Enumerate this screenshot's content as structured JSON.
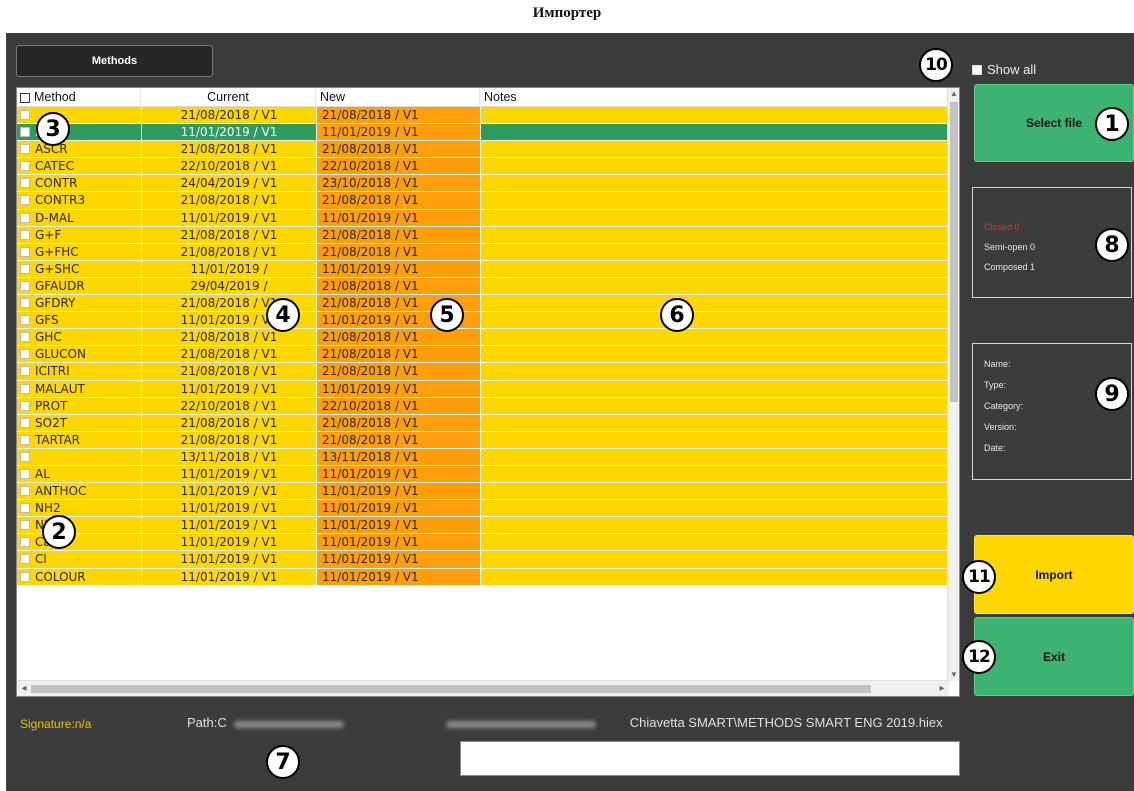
{
  "page_title": "Импортер",
  "tab_methods": "Methods",
  "show_all": "Show all",
  "table": {
    "headers": [
      "Method",
      "Current",
      "New",
      "Notes"
    ],
    "rows": [
      {
        "method": "",
        "current": "21/08/2018 / V1",
        "new": "21/08/2018 / V1",
        "notes": ""
      },
      {
        "method": "RB",
        "current": "11/01/2019 / V1",
        "new": "11/01/2019 / V1",
        "notes": "",
        "selected": true
      },
      {
        "method": "ASCR",
        "current": "21/08/2018 / V1",
        "new": "21/08/2018 / V1",
        "notes": ""
      },
      {
        "method": "CATEC",
        "current": "22/10/2018 / V1",
        "new": "22/10/2018 / V1",
        "notes": ""
      },
      {
        "method": "CONTR",
        "current": "24/04/2019 / V1",
        "new": "23/10/2018 / V1",
        "notes": ""
      },
      {
        "method": "CONTR3",
        "current": "21/08/2018 / V1",
        "new": "21/08/2018 / V1",
        "notes": ""
      },
      {
        "method": "D-MAL",
        "current": "11/01/2019 / V1",
        "new": "11/01/2019 / V1",
        "notes": ""
      },
      {
        "method": "G+F",
        "current": "21/08/2018 / V1",
        "new": "21/08/2018 / V1",
        "notes": ""
      },
      {
        "method": "G+FHC",
        "current": "21/08/2018 / V1",
        "new": "21/08/2018 / V1",
        "notes": ""
      },
      {
        "method": "G+SHC",
        "current": "11/01/2019 /",
        "new": "11/01/2019 / V1",
        "notes": ""
      },
      {
        "method": "GFAUDR",
        "current": "29/04/2019 /",
        "new": "21/08/2018 / V1",
        "notes": ""
      },
      {
        "method": "GFDRY",
        "current": "21/08/2018 / V1",
        "new": "21/08/2018 / V1",
        "notes": ""
      },
      {
        "method": "GFS",
        "current": "11/01/2019 / V1",
        "new": "11/01/2019 / V1",
        "notes": ""
      },
      {
        "method": "GHC",
        "current": "21/08/2018 / V1",
        "new": "21/08/2018 / V1",
        "notes": ""
      },
      {
        "method": "GLUCON",
        "current": "21/08/2018 / V1",
        "new": "21/08/2018 / V1",
        "notes": ""
      },
      {
        "method": "ICITRI",
        "current": "21/08/2018 / V1",
        "new": "21/08/2018 / V1",
        "notes": ""
      },
      {
        "method": "MALAUT",
        "current": "11/01/2019 / V1",
        "new": "11/01/2019 / V1",
        "notes": ""
      },
      {
        "method": "PROT",
        "current": "22/10/2018 / V1",
        "new": "22/10/2018 / V1",
        "notes": ""
      },
      {
        "method": "SO2T",
        "current": "21/08/2018 / V1",
        "new": "21/08/2018 / V1",
        "notes": ""
      },
      {
        "method": "TARTAR",
        "current": "21/08/2018 / V1",
        "new": "21/08/2018 / V1",
        "notes": ""
      },
      {
        "method": "",
        "current": "13/11/2018 / V1",
        "new": "13/11/2018 / V1",
        "notes": ""
      },
      {
        "method": "AL",
        "current": "11/01/2019 / V1",
        "new": "11/01/2019 / V1",
        "notes": ""
      },
      {
        "method": "ANTHOC",
        "current": "11/01/2019 / V1",
        "new": "11/01/2019 / V1",
        "notes": ""
      },
      {
        "method": "NH2",
        "current": "11/01/2019 / V1",
        "new": "11/01/2019 / V1",
        "notes": ""
      },
      {
        "method": "NH3",
        "current": "11/01/2019 / V1",
        "new": "11/01/2019 / V1",
        "notes": ""
      },
      {
        "method": "Ca",
        "current": "11/01/2019 / V1",
        "new": "11/01/2019 / V1",
        "notes": ""
      },
      {
        "method": "Cl",
        "current": "11/01/2019 / V1",
        "new": "11/01/2019 / V1",
        "notes": ""
      },
      {
        "method": "COLOUR",
        "current": "11/01/2019 / V1",
        "new": "11/01/2019 / V1",
        "notes": ""
      }
    ]
  },
  "buttons": {
    "select_file": "Select file",
    "import": "Import",
    "exit": "Exit"
  },
  "status_panel": {
    "closed": "Closed 0",
    "semi_open": "Semi-open 0",
    "composed": "Composed 1"
  },
  "info_panel": {
    "name": "Name:",
    "type": "Type:",
    "category": "Category:",
    "version": "Version:",
    "date": "Date:"
  },
  "signature": "Signature:n/a",
  "path_label": "Path:C",
  "path_tail": "Chiavetta  SMART\\METHODS  SMART  ENG 2019.hiex",
  "callouts": {
    "c1": "1",
    "c2": "2",
    "c3": "3",
    "c4": "4",
    "c5": "5",
    "c6": "6",
    "c7": "7",
    "c8": "8",
    "c9": "9",
    "c10": "10",
    "c11": "11",
    "c12": "12"
  },
  "colors": {
    "row_yellow": "#ffd700",
    "new_orange": "#ff9e0b",
    "selected_green": "#2e9b5f",
    "button_green": "#3cb371",
    "button_yellow": "#ffd700",
    "window_bg": "#3c3c3c"
  }
}
